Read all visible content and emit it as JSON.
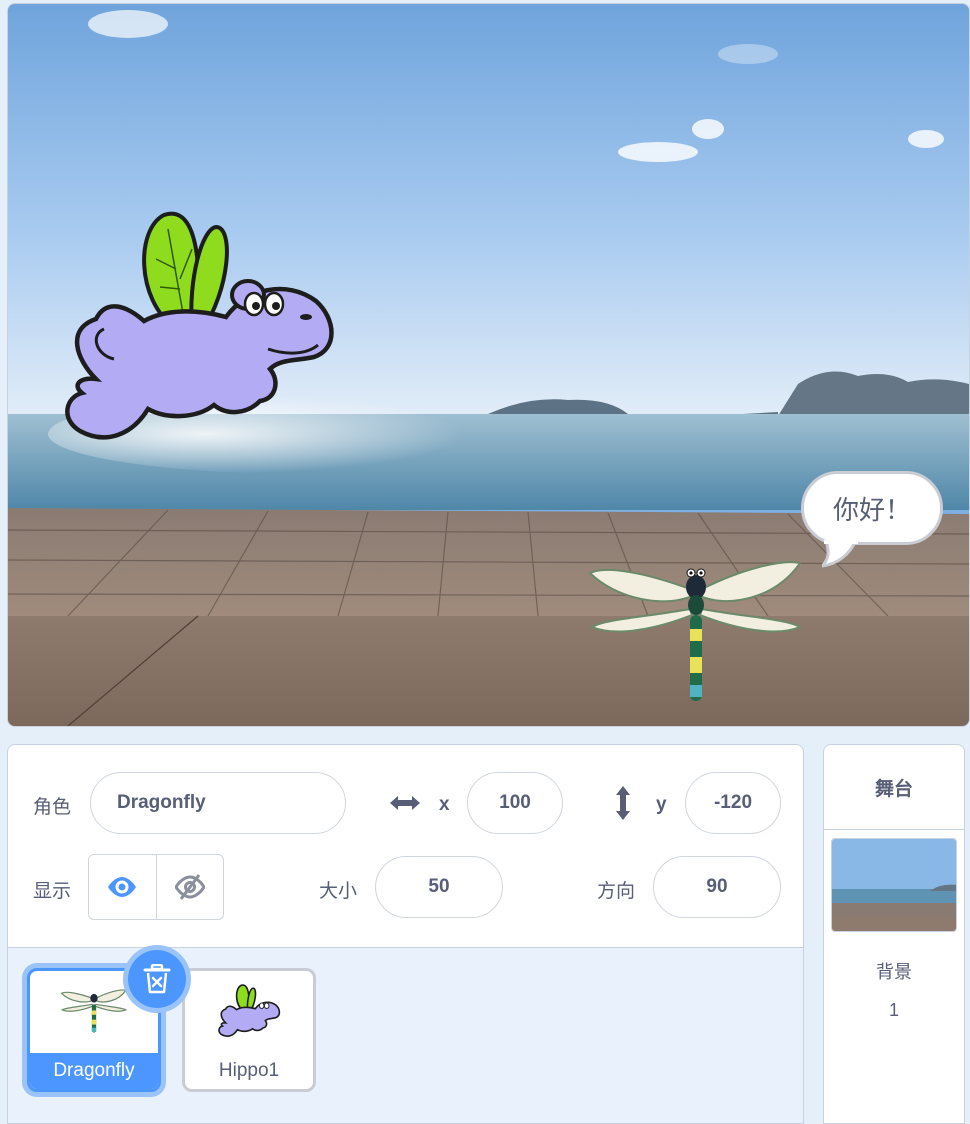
{
  "stage": {
    "speech_bubble": "你好！",
    "sprites": [
      "hippo-sprite",
      "dragonfly-sprite"
    ]
  },
  "sprite_info": {
    "sprite_label": "角色",
    "sprite_name": "Dragonfly",
    "x_label": "x",
    "x_value": "100",
    "y_label": "y",
    "y_value": "-120",
    "show_label": "显示",
    "size_label": "大小",
    "size_value": "50",
    "direction_label": "方向",
    "direction_value": "90"
  },
  "sprite_list": {
    "items": [
      {
        "name": "Dragonfly",
        "selected": true
      },
      {
        "name": "Hippo1",
        "selected": false
      }
    ]
  },
  "stage_selector": {
    "title": "舞台",
    "backdrop_label": "背景",
    "backdrop_count": "1"
  },
  "colors": {
    "accent": "#4c97ff",
    "text": "#575e75",
    "panel_bg": "#e5effa"
  }
}
